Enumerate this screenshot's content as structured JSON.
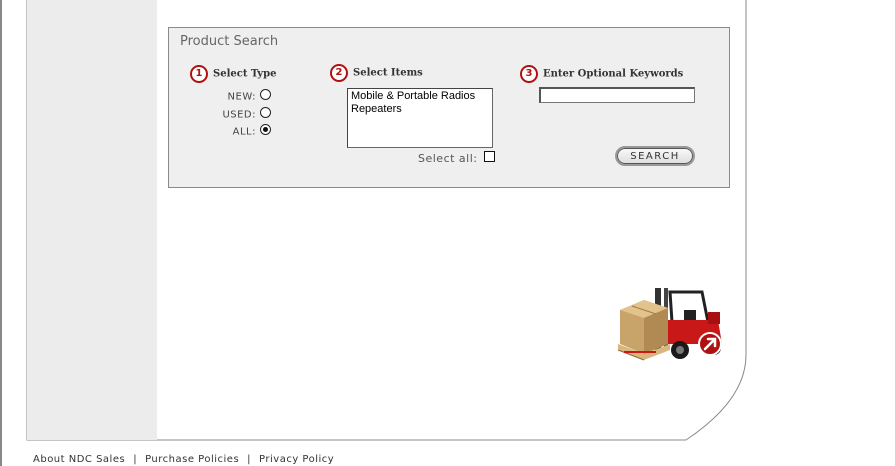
{
  "search": {
    "title": "Product Search",
    "step1": {
      "num": "1",
      "label": "Select Type"
    },
    "step2": {
      "num": "2",
      "label": "Select Items"
    },
    "step3": {
      "num": "3",
      "label": "Enter Optional Keywords"
    },
    "types": [
      {
        "label": "NEW:",
        "checked": false
      },
      {
        "label": "USED:",
        "checked": false
      },
      {
        "label": "ALL:",
        "checked": true
      }
    ],
    "items": [
      "Mobile & Portable Radios",
      "Repeaters"
    ],
    "select_all_label": "Select all:",
    "keywords_value": "",
    "search_button": "SEARCH"
  },
  "footer": {
    "links": [
      "About NDC Sales",
      "Purchase Policies",
      "Privacy Policy"
    ],
    "separator": "|"
  },
  "colors": {
    "accent": "#b01010",
    "sidebar": "#ececec",
    "panel": "#efefef"
  },
  "icons": {
    "promo": "forklift-icon",
    "arrow": "arrow-badge-icon"
  }
}
